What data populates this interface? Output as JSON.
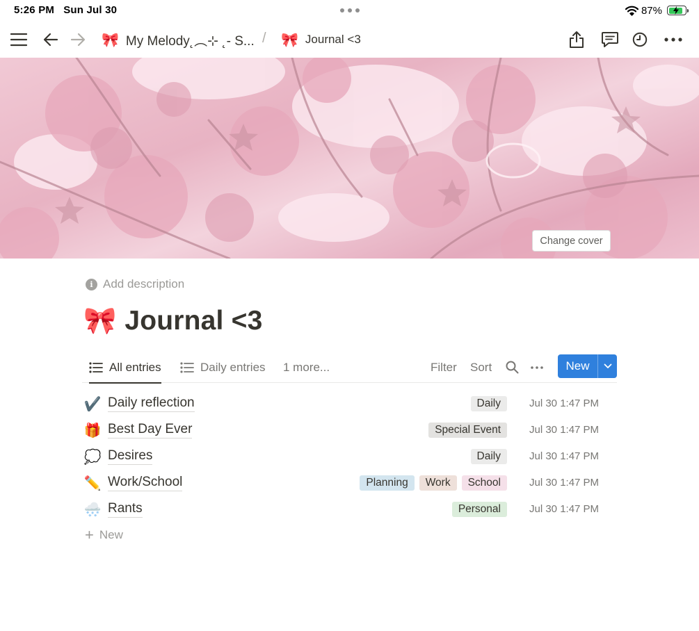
{
  "status_bar": {
    "time": "5:26 PM",
    "date": "Sun Jul 30",
    "battery_percent": "87%",
    "battery_level": 0.87
  },
  "nav": {
    "breadcrumbs": [
      {
        "icon": "🎀",
        "label": "My Melody˛︵⊹ ˛- S..."
      },
      {
        "icon": "🎀",
        "label": "Journal <3"
      }
    ],
    "separator": "/",
    "icons": [
      "menu-icon",
      "back-arrow-icon",
      "forward-arrow-icon",
      "share-icon",
      "comment-icon",
      "clock-icon",
      "more-icon"
    ]
  },
  "cover": {
    "change_label": "Change cover",
    "colors": [
      "#f1c9d5",
      "#e8b3c3",
      "#e4aabd"
    ]
  },
  "page": {
    "add_description": "Add description",
    "title_icon": "🎀",
    "title": "Journal <3"
  },
  "views": {
    "tabs": [
      {
        "label": "All entries",
        "icon": "list-icon",
        "active": true
      },
      {
        "label": "Daily entries",
        "icon": "list-icon",
        "active": false
      },
      {
        "label": "1 more...",
        "active": false
      }
    ],
    "filter": "Filter",
    "sort": "Sort",
    "new_label": "New",
    "accent": "#2f80dd"
  },
  "entries": [
    {
      "icon": "✔️",
      "title": "Daily reflection",
      "tags": [
        {
          "label": "Daily",
          "color": "#ebebea"
        }
      ],
      "date": "Jul 30 1:47 PM"
    },
    {
      "icon": "🎁",
      "title": "Best Day Ever",
      "tags": [
        {
          "label": "Special Event",
          "color": "#e3e2e0"
        }
      ],
      "date": "Jul 30 1:47 PM"
    },
    {
      "icon": "💭",
      "title": "Desires",
      "tags": [
        {
          "label": "Daily",
          "color": "#ebebea"
        }
      ],
      "date": "Jul 30 1:47 PM"
    },
    {
      "icon": "✏️",
      "title": "Work/School",
      "tags": [
        {
          "label": "Planning",
          "color": "#d3e5ef"
        },
        {
          "label": "Work",
          "color": "#eee0da"
        },
        {
          "label": "School",
          "color": "#f5e0e9"
        }
      ],
      "date": "Jul 30 1:47 PM"
    },
    {
      "icon": "🌨️",
      "title": "Rants",
      "tags": [
        {
          "label": "Personal",
          "color": "#dbeddb"
        }
      ],
      "date": "Jul 30 1:47 PM"
    }
  ],
  "new_row_label": "New"
}
